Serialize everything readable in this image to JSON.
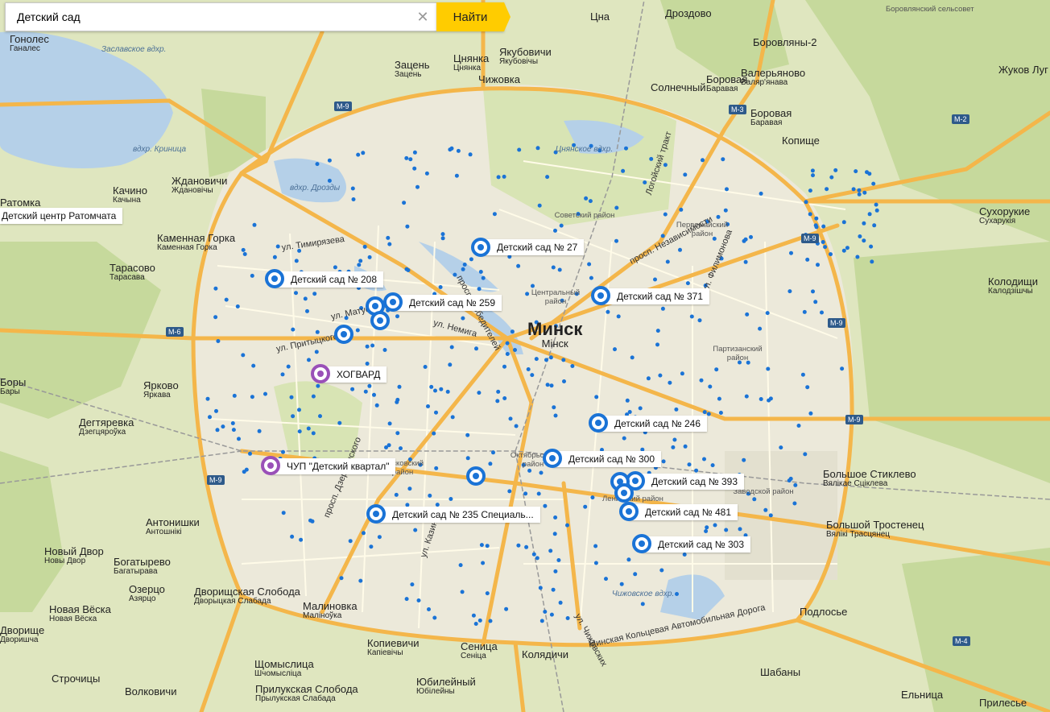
{
  "search": {
    "query": "Детский сад",
    "find_label": "Найти"
  },
  "city": {
    "name": "Минск",
    "name_by": "Мінск"
  },
  "towns": [
    {
      "name": "Гонолес",
      "sub": "Ганалес"
    },
    {
      "name": "Зацень",
      "sub": "Зацень"
    },
    {
      "name": "Цнянка",
      "sub": "Цнянка"
    },
    {
      "name": "Якубовичи",
      "sub": "Якубовічы"
    },
    {
      "name": "Чижовка",
      "sub": ""
    },
    {
      "name": "Цна",
      "sub": ""
    },
    {
      "name": "Дроздово",
      "sub": ""
    },
    {
      "name": "Боровляны-2",
      "sub": ""
    },
    {
      "name": "Валерьяново",
      "sub": "Валяр'янава"
    },
    {
      "name": "Боровая",
      "sub": "Баравая"
    },
    {
      "name": "Солнечный",
      "sub": ""
    },
    {
      "name": "Боровая",
      "sub": "Баравая"
    },
    {
      "name": "Копище",
      "sub": ""
    },
    {
      "name": "Жуков Луг",
      "sub": ""
    },
    {
      "name": "Сухорукие",
      "sub": "Сухарукія"
    },
    {
      "name": "Колодищи",
      "sub": "Калодзішчы"
    },
    {
      "name": "Качино",
      "sub": "Качына"
    },
    {
      "name": "Ждановичи",
      "sub": "Ждановічы"
    },
    {
      "name": "Ратомка",
      "sub": ""
    },
    {
      "name": "Каменная Горка",
      "sub": "Каменная Горка"
    },
    {
      "name": "Тарасово",
      "sub": "Тарасава"
    },
    {
      "name": "Ярково",
      "sub": "Яркава"
    },
    {
      "name": "Боры",
      "sub": "Бары"
    },
    {
      "name": "Дегтяревка",
      "sub": "Дзегцяроўка"
    },
    {
      "name": "Антонишки",
      "sub": "Антошнікі"
    },
    {
      "name": "Новый Двор",
      "sub": "Новы Двор"
    },
    {
      "name": "Богатырево",
      "sub": "Багатырава"
    },
    {
      "name": "Озерцо",
      "sub": "Азярцо"
    },
    {
      "name": "Новая Вёска",
      "sub": "Новая Вёска"
    },
    {
      "name": "Дворищская Слобода",
      "sub": "Дворыцкая Слабада"
    },
    {
      "name": "Малиновка",
      "sub": "Маліноўка"
    },
    {
      "name": "Копиевичи",
      "sub": "Капіевічы"
    },
    {
      "name": "Сеница",
      "sub": "Сеніца"
    },
    {
      "name": "Колядичи",
      "sub": ""
    },
    {
      "name": "Щомыслица",
      "sub": "Шчомысліца"
    },
    {
      "name": "Прилукская Слобода",
      "sub": "Прылукская Слабада"
    },
    {
      "name": "Юбилейный",
      "sub": "Юбілейны"
    },
    {
      "name": "Строчицы",
      "sub": ""
    },
    {
      "name": "Волковичи",
      "sub": ""
    },
    {
      "name": "Дворищe",
      "sub": "Дворишча"
    },
    {
      "name": "Большое Стиклево",
      "sub": "Вялікае Сціклева"
    },
    {
      "name": "Большой Тростенец",
      "sub": "Вялікі Трасцянец"
    },
    {
      "name": "Подлосье",
      "sub": ""
    },
    {
      "name": "Шабаны",
      "sub": ""
    },
    {
      "name": "Ельница",
      "sub": ""
    },
    {
      "name": "Прилесье",
      "sub": ""
    }
  ],
  "water": [
    "Заславское вдхр.",
    "вдхр. Криница",
    "вдхр. Дрозды",
    "Цнянское вдхр.",
    "Чижовское вдхр."
  ],
  "districts": [
    "Советский район",
    "Первомайский район",
    "Центральный район",
    "Партизанский район",
    "Октябрьский район",
    "Ленинский район",
    "Московский район",
    "Заводской район",
    "Боровлянский сельсовет"
  ],
  "streets": [
    "ул. Тимирязева",
    "ул. Матусевича",
    "ул. Притыцкого",
    "просп. Победителей",
    "ул. Немига",
    "просп. Независимости",
    "Логойский тракт",
    "ул. Филимонова",
    "просп. Дзержинского",
    "ул. Казинца",
    "ул. Чижевских",
    "Минская Кольцевая Автомобильная Дорога"
  ],
  "roads": [
    "М-9",
    "М-9",
    "М-9",
    "М-9",
    "М-9",
    "М-6",
    "М-3",
    "М-2",
    "М-4"
  ],
  "places": [
    {
      "label": "Детский центр Ратомчата",
      "type": "label"
    },
    {
      "label": "Детский сад № 27",
      "type": "blue"
    },
    {
      "label": "Детский сад № 208",
      "type": "blue"
    },
    {
      "label": "Детский сад № 259",
      "type": "blue"
    },
    {
      "label": "Детский сад № 371",
      "type": "blue"
    },
    {
      "label": "ХОГВАРД",
      "type": "purple"
    },
    {
      "label": "Детский сад № 246",
      "type": "blue"
    },
    {
      "label": "Детский сад № 300",
      "type": "blue"
    },
    {
      "label": "ЧУП \"Детский квартал\"",
      "type": "purple"
    },
    {
      "label": "Детский сад № 393",
      "type": "blue"
    },
    {
      "label": "Детский сад № 481",
      "type": "blue"
    },
    {
      "label": "Детский сад № 235 Специаль...",
      "type": "blue"
    },
    {
      "label": "Детский сад № 303",
      "type": "blue"
    }
  ],
  "colors": {
    "land": "#dfe6bf",
    "forest": "#c8dba0",
    "urban": "#ece8d8",
    "water": "#b5d0e8",
    "road_major": "#f4b64a",
    "road_minor": "#ffffff",
    "pin_blue": "#1a73d6",
    "pin_purple": "#9a50b8",
    "search_button": "#ffcc00"
  }
}
